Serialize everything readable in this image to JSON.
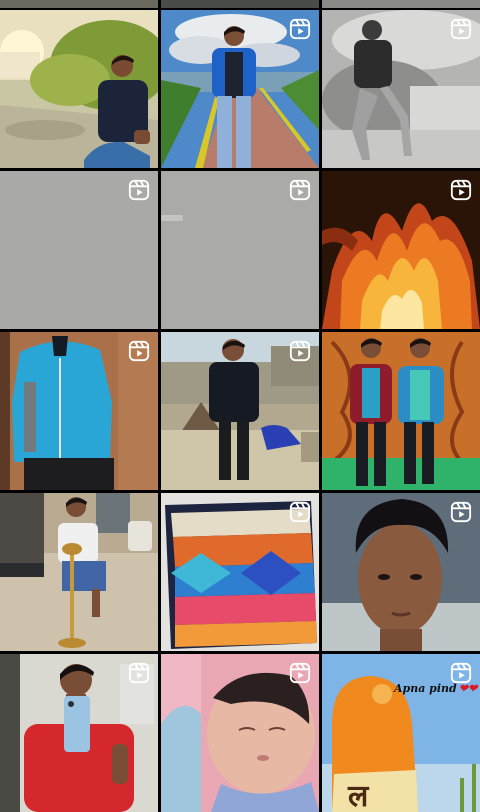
{
  "grid": {
    "columns": 3,
    "tile_count": 15,
    "badge_icon": "reels-icon",
    "tiles": [
      {
        "name": "post-1",
        "type": "photo",
        "reel": false
      },
      {
        "name": "post-2",
        "type": "reel",
        "reel": true
      },
      {
        "name": "post-3",
        "type": "reel",
        "reel": true
      },
      {
        "name": "post-4",
        "type": "reel",
        "reel": true
      },
      {
        "name": "post-5",
        "type": "reel",
        "reel": true
      },
      {
        "name": "post-6",
        "type": "reel",
        "reel": true
      },
      {
        "name": "post-7",
        "type": "reel",
        "reel": true
      },
      {
        "name": "post-8",
        "type": "photo",
        "reel": false
      },
      {
        "name": "post-9",
        "type": "photo",
        "reel": false
      },
      {
        "name": "post-10",
        "type": "photo",
        "reel": false
      },
      {
        "name": "post-11",
        "type": "reel",
        "reel": true
      },
      {
        "name": "post-12",
        "type": "reel",
        "reel": true
      },
      {
        "name": "post-13",
        "type": "reel",
        "reel": true
      },
      {
        "name": "post-14",
        "type": "reel",
        "reel": true
      },
      {
        "name": "post-15",
        "type": "reel",
        "reel": true,
        "caption": "Apna pind",
        "caption_icon": "hearts-icon"
      }
    ]
  },
  "colors": {
    "background": "#000000",
    "badge": "#ffffff",
    "caption_heart": "#d81b28"
  }
}
